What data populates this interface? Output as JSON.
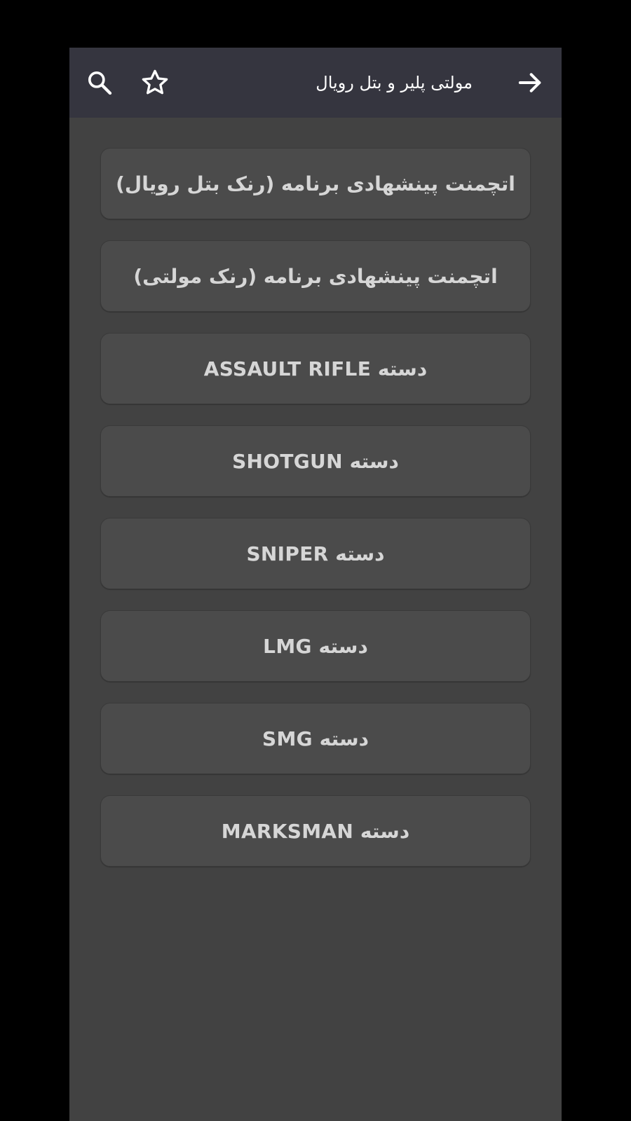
{
  "toolbar": {
    "title": "مولتی پلیر و بتل رویال",
    "icons": {
      "search": "search-icon",
      "favorite": "star-outline-icon",
      "back": "arrow-right-icon"
    },
    "background": "#35353f",
    "icon_color": "#ffffff"
  },
  "list": {
    "items": [
      {
        "label": "اتچمنت پینشهادی برنامه (رنک بتل رویال)"
      },
      {
        "label": "اتچمنت پینشهادی برنامه (رنک مولتی)"
      },
      {
        "label": "دسته  ASSAULT RIFLE"
      },
      {
        "label": "دسته SHOTGUN"
      },
      {
        "label": "دسته SNIPER"
      },
      {
        "label": "دسته LMG"
      },
      {
        "label": "دسته SMG"
      },
      {
        "label": "دسته MARKSMAN"
      }
    ]
  },
  "colors": {
    "screen_background": "#424242",
    "item_background": "#4b4b4b",
    "item_text": "#d6d6d6"
  }
}
